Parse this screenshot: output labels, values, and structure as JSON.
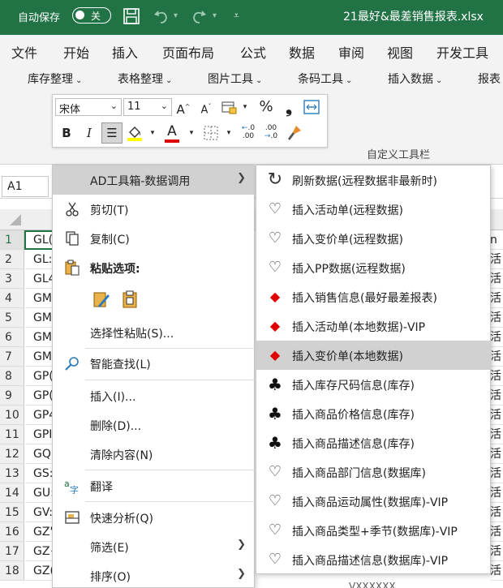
{
  "titlebar": {
    "autosave_label": "自动保存",
    "autosave_state": "关",
    "filename": "21最好&最差销售报表.xlsx"
  },
  "ribbon": {
    "tabs": [
      "文件",
      "开始",
      "插入",
      "页面布局",
      "公式",
      "数据",
      "审阅",
      "视图",
      "开发工具"
    ],
    "groups": [
      "库存整理",
      "表格整理",
      "图片工具",
      "条码工具",
      "插入数据",
      "报表"
    ],
    "font_name": "宋体",
    "font_size": "11",
    "custom_group_label": "自定义工具栏"
  },
  "formula_bar": {
    "name_box": "A1"
  },
  "grid": {
    "row_numbers": [
      "1",
      "2",
      "3",
      "4",
      "5",
      "6",
      "7",
      "8",
      "9",
      "10",
      "11",
      "12",
      "13",
      "14",
      "15",
      "16",
      "17",
      "18"
    ],
    "col_a": [
      "GL(",
      "GL:",
      "GL4",
      "GM:",
      "GM4",
      "GM(",
      "GM(",
      "GP(",
      "GP(",
      "GP4",
      "GPI",
      "GQ:",
      "GS:",
      "GU:",
      "GV:",
      "GZ'",
      "GZ{",
      "GZ("
    ],
    "col_right": [
      "n",
      "活",
      "活",
      "活",
      "活",
      "活",
      "活",
      "活",
      "活",
      "活",
      "活",
      "活",
      "活",
      "活",
      "活",
      "活",
      "活",
      "活"
    ],
    "bottom_partial": "VXXXXXX"
  },
  "context_menu": {
    "items": [
      {
        "label": "AD工具箱-数据调用",
        "icon": "",
        "has_submenu": true,
        "highlighted": true
      },
      {
        "label": "剪切(T)",
        "icon": "scissors-icon"
      },
      {
        "label": "复制(C)",
        "icon": "copy-icon"
      },
      {
        "label": "粘贴选项:",
        "icon": "paste-icon",
        "bold": true
      },
      {
        "label": "选择性粘贴(S)...",
        "icon": ""
      },
      {
        "label": "智能查找(L)",
        "icon": "search-icon"
      },
      {
        "label": "插入(I)...",
        "icon": ""
      },
      {
        "label": "删除(D)...",
        "icon": ""
      },
      {
        "label": "清除内容(N)",
        "icon": ""
      },
      {
        "label": "翻译",
        "icon": "translate-icon"
      },
      {
        "label": "快速分析(Q)",
        "icon": "quick-analysis-icon"
      },
      {
        "label": "筛选(E)",
        "icon": "",
        "has_submenu": true
      },
      {
        "label": "排序(O)",
        "icon": "",
        "has_submenu": true
      }
    ]
  },
  "submenu": {
    "items": [
      {
        "label": "刷新数据(远程数据非最新时)",
        "icon": "refresh-icon"
      },
      {
        "label": "插入活动单(远程数据)",
        "icon": "heart-icon"
      },
      {
        "label": "插入变价单(远程数据)",
        "icon": "heart-icon"
      },
      {
        "label": "插入PP数据(远程数据)",
        "icon": "heart-icon"
      },
      {
        "label": "插入销售信息(最好最差报表)",
        "icon": "diamond-icon"
      },
      {
        "label": "插入活动单(本地数据)-VIP",
        "icon": "diamond-icon"
      },
      {
        "label": "插入变价单(本地数据)",
        "icon": "diamond-icon",
        "highlighted": true
      },
      {
        "label": "插入库存尺码信息(库存)",
        "icon": "club-icon"
      },
      {
        "label": "插入商品价格信息(库存)",
        "icon": "club-icon"
      },
      {
        "label": "插入商品描述信息(库存)",
        "icon": "club-icon"
      },
      {
        "label": "插入商品部门信息(数据库)",
        "icon": "heart-icon"
      },
      {
        "label": "插入商品运动属性(数据库)-VIP",
        "icon": "heart-icon"
      },
      {
        "label": "插入商品类型+季节(数据库)-VIP",
        "icon": "heart-icon"
      },
      {
        "label": "插入商品描述信息(数据库)-VIP",
        "icon": "heart-icon"
      }
    ]
  },
  "colors": {
    "excel_green": "#217346",
    "diamond_red": "#e00000",
    "highlight_gray": "#d1d1d1"
  }
}
